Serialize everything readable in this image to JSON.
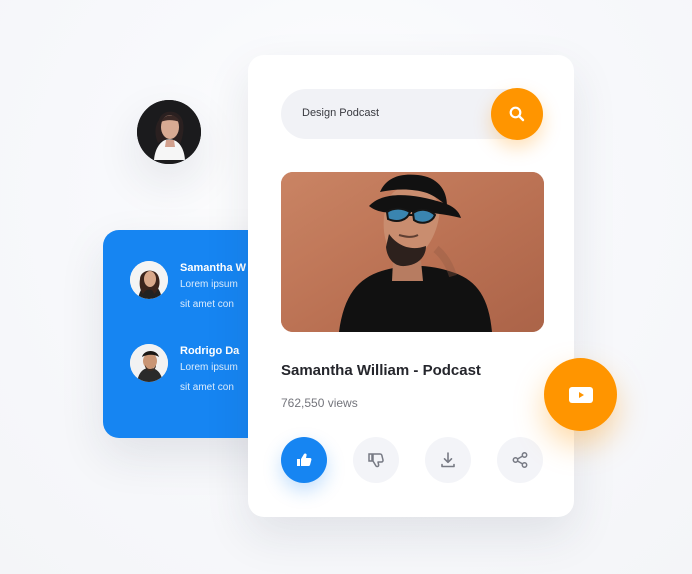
{
  "search": {
    "value": "Design Podcast",
    "icon": "search-icon"
  },
  "video": {
    "title": "Samantha William - Podcast",
    "views": "762,550 views"
  },
  "comments": [
    {
      "name": "Samantha W",
      "lines": [
        "Lorem ipsum",
        "sit amet con"
      ]
    },
    {
      "name": "Rodrigo Da",
      "lines": [
        "Lorem ipsum",
        "sit amet con"
      ]
    }
  ],
  "actions": [
    {
      "icon": "thumbs-up-icon",
      "active": true
    },
    {
      "icon": "thumbs-down-icon",
      "active": false
    },
    {
      "icon": "download-icon",
      "active": false
    },
    {
      "icon": "share-icon",
      "active": false
    }
  ],
  "floating_button": {
    "icon": "video-play-icon"
  },
  "colors": {
    "accent": "#ff9500",
    "primary_blue": "#1685f2",
    "card": "#ffffff",
    "text": "#25262c"
  }
}
